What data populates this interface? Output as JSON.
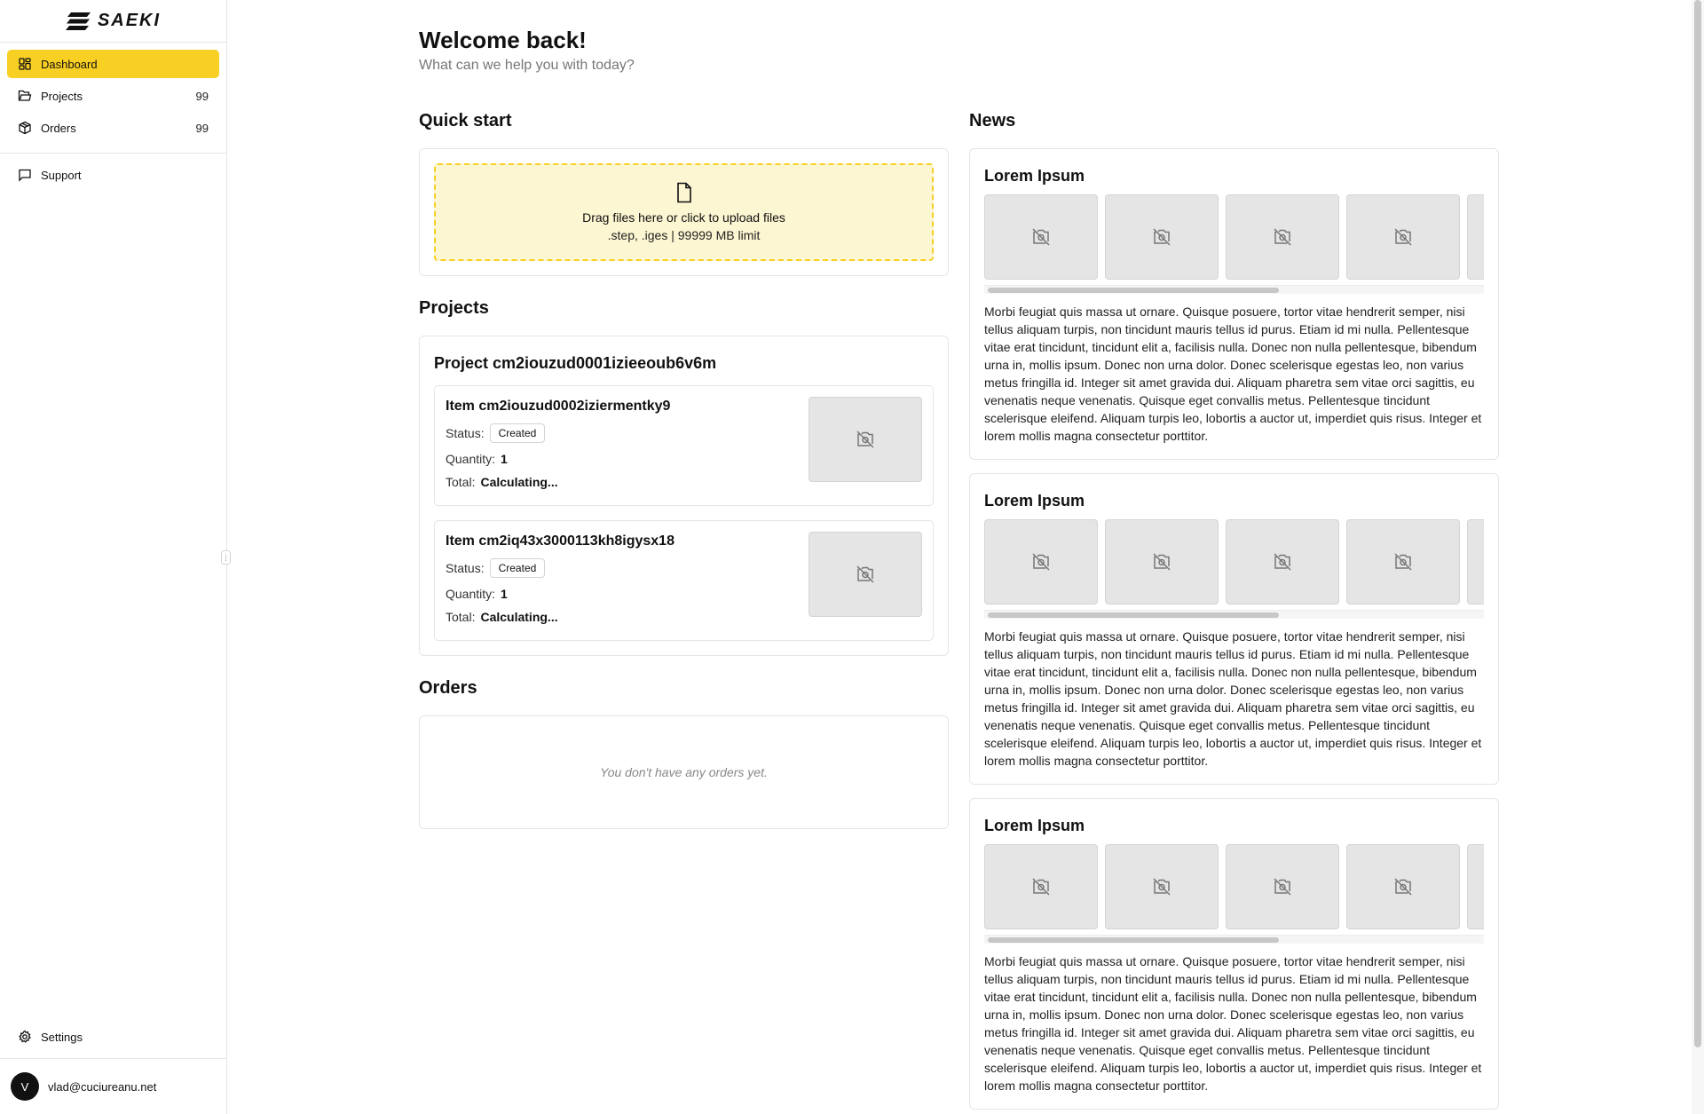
{
  "brand": {
    "name": "SAEKI"
  },
  "sidebar": {
    "items": [
      {
        "label": "Dashboard",
        "icon": "dashboard-icon",
        "active": true,
        "count": ""
      },
      {
        "label": "Projects",
        "icon": "folder-icon",
        "active": false,
        "count": "99"
      },
      {
        "label": "Orders",
        "icon": "box-icon",
        "active": false,
        "count": "99"
      }
    ],
    "support": {
      "label": "Support",
      "icon": "chat-icon"
    },
    "settings": {
      "label": "Settings",
      "icon": "gear-icon"
    },
    "user": {
      "initial": "V",
      "email": "vlad@cuciureanu.net"
    }
  },
  "header": {
    "title": "Welcome back!",
    "subtitle": "What can we help you with today?"
  },
  "quick_start": {
    "title": "Quick start",
    "dropzone_text": "Drag files here or click to upload files",
    "dropzone_hint": ".step, .iges | 99999 MB limit"
  },
  "projects": {
    "title": "Projects",
    "project_name": "Project cm2iouzud0001izieeoub6v6m",
    "items": [
      {
        "name": "Item cm2iouzud0002iziermentky9",
        "status_label": "Status:",
        "status": "Created",
        "quantity_label": "Quantity:",
        "quantity": "1",
        "total_label": "Total:",
        "total": "Calculating..."
      },
      {
        "name": "Item cm2iq43x3000113kh8igysx18",
        "status_label": "Status:",
        "status": "Created",
        "quantity_label": "Quantity:",
        "quantity": "1",
        "total_label": "Total:",
        "total": "Calculating..."
      }
    ]
  },
  "orders": {
    "title": "Orders",
    "empty_text": "You don't have any orders yet."
  },
  "news": {
    "title": "News",
    "articles": [
      {
        "title": "Lorem Ipsum",
        "body": "Morbi feugiat quis massa ut ornare. Quisque posuere, tortor vitae hendrerit semper, nisi tellus aliquam turpis, non tincidunt mauris tellus id purus. Etiam id mi nulla. Pellentesque vitae erat tincidunt, tincidunt elit a, facilisis nulla. Donec non nulla pellentesque, bibendum urna in, mollis ipsum. Donec non urna dolor. Donec scelerisque egestas leo, non varius metus fringilla id. Integer sit amet gravida dui. Aliquam pharetra sem vitae orci sagittis, eu venenatis neque venenatis. Quisque eget convallis metus. Pellentesque tincidunt scelerisque eleifend. Aliquam turpis leo, lobortis a auctor ut, imperdiet quis risus. Integer et lorem mollis magna consectetur porttitor."
      },
      {
        "title": "Lorem Ipsum",
        "body": "Morbi feugiat quis massa ut ornare. Quisque posuere, tortor vitae hendrerit semper, nisi tellus aliquam turpis, non tincidunt mauris tellus id purus. Etiam id mi nulla. Pellentesque vitae erat tincidunt, tincidunt elit a, facilisis nulla. Donec non nulla pellentesque, bibendum urna in, mollis ipsum. Donec non urna dolor. Donec scelerisque egestas leo, non varius metus fringilla id. Integer sit amet gravida dui. Aliquam pharetra sem vitae orci sagittis, eu venenatis neque venenatis. Quisque eget convallis metus. Pellentesque tincidunt scelerisque eleifend. Aliquam turpis leo, lobortis a auctor ut, imperdiet quis risus. Integer et lorem mollis magna consectetur porttitor."
      },
      {
        "title": "Lorem Ipsum",
        "body": "Morbi feugiat quis massa ut ornare. Quisque posuere, tortor vitae hendrerit semper, nisi tellus aliquam turpis, non tincidunt mauris tellus id purus. Etiam id mi nulla. Pellentesque vitae erat tincidunt, tincidunt elit a, facilisis nulla. Donec non nulla pellentesque, bibendum urna in, mollis ipsum. Donec non urna dolor. Donec scelerisque egestas leo, non varius metus fringilla id. Integer sit amet gravida dui. Aliquam pharetra sem vitae orci sagittis, eu venenatis neque venenatis. Quisque eget convallis metus. Pellentesque tincidunt scelerisque eleifend. Aliquam turpis leo, lobortis a auctor ut, imperdiet quis risus. Integer et lorem mollis magna consectetur porttitor."
      }
    ]
  },
  "colors": {
    "accent": "#f8cf23",
    "dropzone_bg": "#fdf6d2",
    "placeholder_bg": "#e5e5e5"
  }
}
